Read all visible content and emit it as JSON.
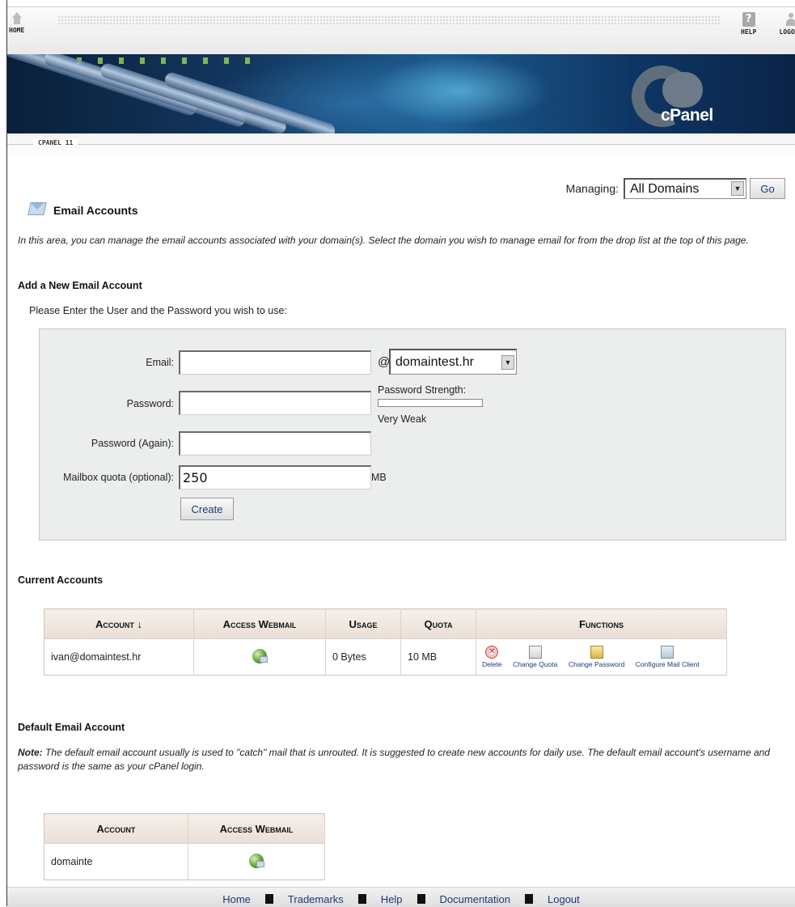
{
  "nav": {
    "home_label": "HOME",
    "help_label": "HELP",
    "logout_label": "LOGOUT"
  },
  "banner": {
    "logo_text": "cPanel"
  },
  "version_label": "CPANEL 11",
  "managing": {
    "label": "Managing:",
    "selected": "All Domains",
    "go_label": "Go"
  },
  "page": {
    "title": "Email Accounts",
    "intro": "In this area, you can manage the email accounts associated with your domain(s). Select the domain you wish to manage email for from the drop list at the top of this page."
  },
  "add_account": {
    "heading": "Add a New Email Account",
    "instructions": "Please Enter the User and the Password you wish to use:",
    "email_label": "Email:",
    "email_value": "",
    "at_symbol": "@",
    "domain_selected": "domaintest.hr",
    "password_label": "Password:",
    "password_again_label": "Password (Again):",
    "strength_label": "Password Strength:",
    "strength_value": "Very Weak",
    "strength_fraction": 0,
    "quota_label": "Mailbox quota (optional):",
    "quota_value": "250",
    "quota_unit": "MB",
    "create_label": "Create"
  },
  "current_accounts": {
    "heading": "Current Accounts",
    "columns": [
      "Account ↓",
      "Access Webmail",
      "Usage",
      "Quota",
      "Functions"
    ],
    "rows": [
      {
        "account": "ivan@domaintest.hr",
        "usage": "0 Bytes",
        "quota": "10 MB"
      }
    ],
    "functions": {
      "delete": "Delete",
      "change_quota": "Change Quota",
      "change_password": "Change Password",
      "configure": "Configure Mail Client"
    }
  },
  "default_account": {
    "heading": "Default Email Account",
    "note_label": "Note:",
    "note_text": " The default email account usually is used to \"catch\" mail that is unrouted. It is suggested to create new accounts for daily use. The default email account's username and password is the same as your cPanel login.",
    "columns": [
      "Account",
      "Access Webmail"
    ],
    "account": "domainte"
  },
  "footer": {
    "links": [
      "Home",
      "Trademarks",
      "Help",
      "Documentation",
      "Logout"
    ]
  },
  "colors": {
    "link": "#1b3a7a",
    "header_bg": "#eadfd6",
    "form_bg": "#eceeee"
  }
}
